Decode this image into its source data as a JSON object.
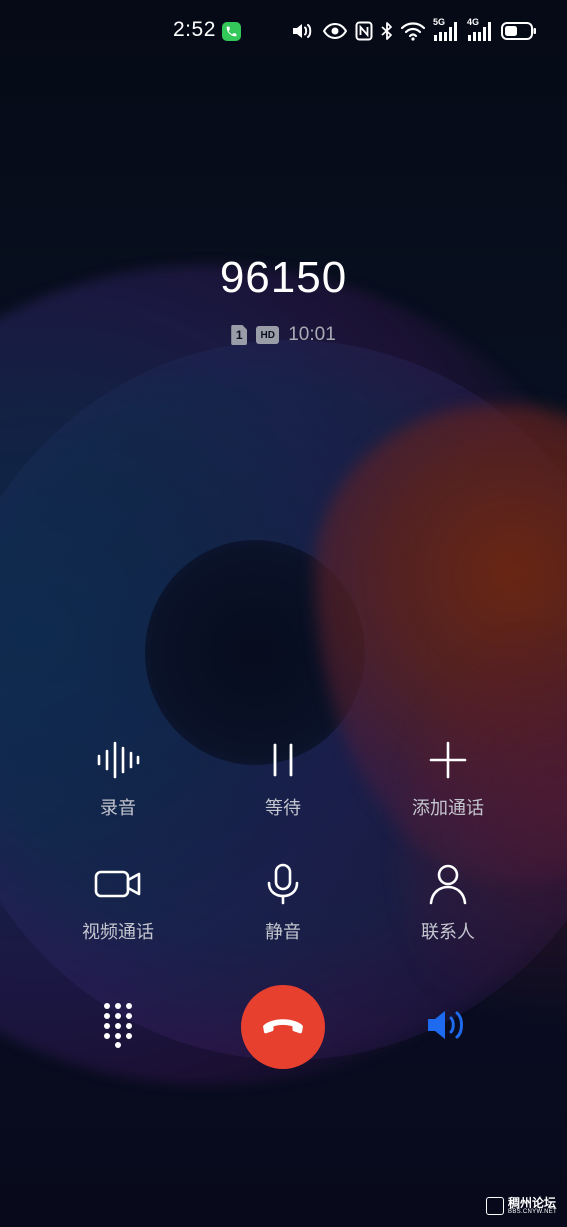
{
  "status_bar": {
    "time": "2:52",
    "icons": [
      "call-active-icon",
      "volume-icon",
      "eye-icon",
      "nfc-icon",
      "bluetooth-icon",
      "wifi-icon",
      "signal-5g-icon",
      "signal-4g-icon",
      "battery-icon"
    ],
    "network_1": "5G",
    "network_2": "4G",
    "battery_level": 0.5
  },
  "call": {
    "number": "96150",
    "sim_slot": "1",
    "hd_label": "HD",
    "duration": "10:01"
  },
  "controls": {
    "record": {
      "label": "录音",
      "icon": "waveform-icon"
    },
    "hold": {
      "label": "等待",
      "icon": "pause-icon"
    },
    "add_call": {
      "label": "添加通话",
      "icon": "plus-icon"
    },
    "video_call": {
      "label": "视频通话",
      "icon": "video-camera-icon"
    },
    "mute": {
      "label": "静音",
      "icon": "microphone-icon"
    },
    "contacts": {
      "label": "联系人",
      "icon": "person-icon"
    }
  },
  "bottom": {
    "dialpad_icon": "dialpad-icon",
    "end_call_icon": "hang-up-icon",
    "speaker_icon": "speaker-icon",
    "speaker_active_color": "#1f6bf0",
    "end_call_color": "#e8402f"
  },
  "watermark": {
    "title": "稠州论坛",
    "subtitle": "BBS.CNYW.NET"
  }
}
